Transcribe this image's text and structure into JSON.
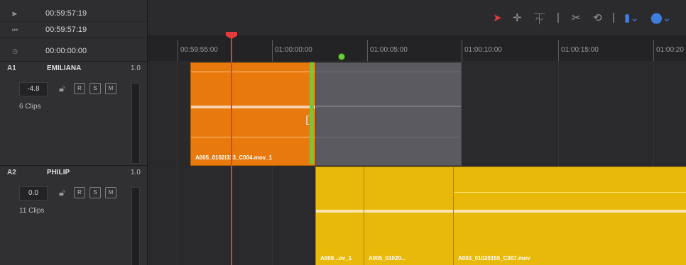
{
  "timecodes": [
    {
      "icon": "play-next-icon",
      "value": "00:59:57:19"
    },
    {
      "icon": "skip-to-start-icon",
      "value": "00:59:57:19"
    },
    {
      "icon": "clock-icon",
      "value": "00:00:00:00"
    }
  ],
  "tracks": [
    {
      "id": "A1",
      "name": "EMILIANA",
      "volume": "1.0",
      "level": "-4.8",
      "clips": "6 Clips",
      "buttons": {
        "r": "R",
        "s": "S",
        "m": "M"
      }
    },
    {
      "id": "A2",
      "name": "PHILIP",
      "volume": "1.0",
      "level": "0.0",
      "clips": "11 Clips",
      "buttons": {
        "r": "R",
        "s": "S",
        "m": "M"
      }
    }
  ],
  "toolbar": {
    "icons": [
      "pointer-icon",
      "crosshair-icon",
      "blade-insert-icon",
      "scissors-icon",
      "link-icon",
      "flag-dropdown-icon",
      "marker-dropdown-icon"
    ],
    "accent": "#e23b3b",
    "marker_color": "#3f7de0"
  },
  "ruler": {
    "labels": [
      "00:59:55:00",
      "01:00:00:00",
      "01:00:05:00",
      "01:00:10:00",
      "01:00:15:00",
      "01:00:20"
    ]
  },
  "clips": {
    "a1": [
      {
        "label": "A005_0102l333_C004.mov_1",
        "color": "#e87a0d"
      },
      {
        "label": "",
        "color": "#5a5a60"
      }
    ],
    "a2": [
      {
        "label": "A009...ov_1",
        "color": "#e8b90b"
      },
      {
        "label": "A005_01020...",
        "color": "#e8b90b"
      },
      {
        "label": "A003_01020155_C007.mov",
        "color": "#e8b90b"
      }
    ]
  }
}
